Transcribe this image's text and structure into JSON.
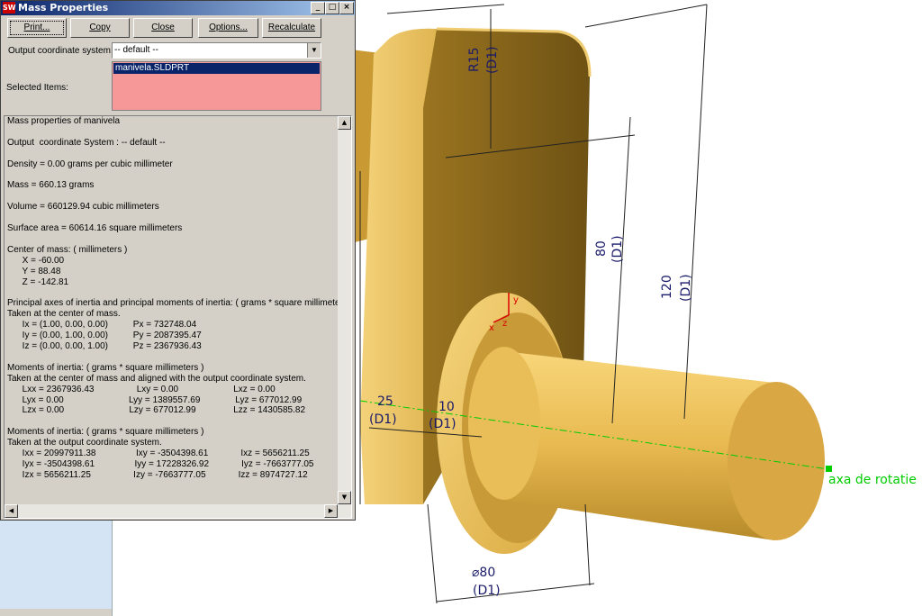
{
  "window": {
    "title": "Mass Properties",
    "logo_text": "SW",
    "controls": [
      "_",
      "□",
      "×"
    ]
  },
  "buttons": {
    "print": "Print...",
    "copy": "Copy",
    "close": "Close",
    "options": "Options...",
    "recalculate": "Recalculate"
  },
  "coord": {
    "label": "Output coordinate system:",
    "value": "-- default --"
  },
  "selected": {
    "label": "Selected Items:",
    "items": [
      "manivela.SLDPRT"
    ]
  },
  "results": {
    "lines": [
      "Mass properties of manivela",
      "",
      "Output  coordinate System : -- default --",
      "",
      "Density = 0.00 grams per cubic millimeter",
      "",
      "Mass = 660.13 grams",
      "",
      "Volume = 660129.94 cubic millimeters",
      "",
      "Surface area = 60614.16 square millimeters",
      "",
      "Center of mass: ( millimeters )",
      "      X = -60.00",
      "      Y = 88.48",
      "      Z = -142.81",
      "",
      "Principal axes of inertia and principal moments of inertia: ( grams * square millimeters )",
      "Taken at the center of mass.",
      "      Ix = (1.00, 0.00, 0.00)          Px = 732748.04",
      "      Iy = (0.00, 1.00, 0.00)          Py = 2087395.47",
      "      Iz = (0.00, 0.00, 1.00)          Pz = 2367936.43",
      "",
      "Moments of inertia: ( grams * square millimeters )",
      "Taken at the center of mass and aligned with the output coordinate system.",
      "      Lxx = 2367936.43                 Lxy = 0.00                      Lxz = 0.00",
      "      Lyx = 0.00                          Lyy = 1389557.69              Lyz = 677012.99",
      "      Lzx = 0.00                          Lzy = 677012.99               Lzz = 1430585.82",
      "",
      "Moments of inertia: ( grams * square millimeters )",
      "Taken at the output coordinate system.",
      "      Ixx = 20997911.38                Ixy = -3504398.61             Ixz = 5656211.25",
      "      Iyx = -3504398.61                Iyy = 17228326.92             Iyz = -7663777.05",
      "      Izx = 5656211.25                 Izy = -7663777.05             Izz = 8974727.12"
    ]
  },
  "model": {
    "dims": {
      "r15": "R15",
      "d1": "(D1)",
      "v80": "80",
      "v120": "120",
      "v25": "25",
      "v10": "10",
      "dia80": "⌀80"
    },
    "axis_label": "axa de rotatie",
    "triad": {
      "x": "x",
      "y": "y",
      "z": "z"
    },
    "colors": {
      "part": "#e6b64a",
      "part_dark": "#8a6a1c",
      "axis": "#00cc00",
      "dim": "#1a1a6a"
    }
  }
}
